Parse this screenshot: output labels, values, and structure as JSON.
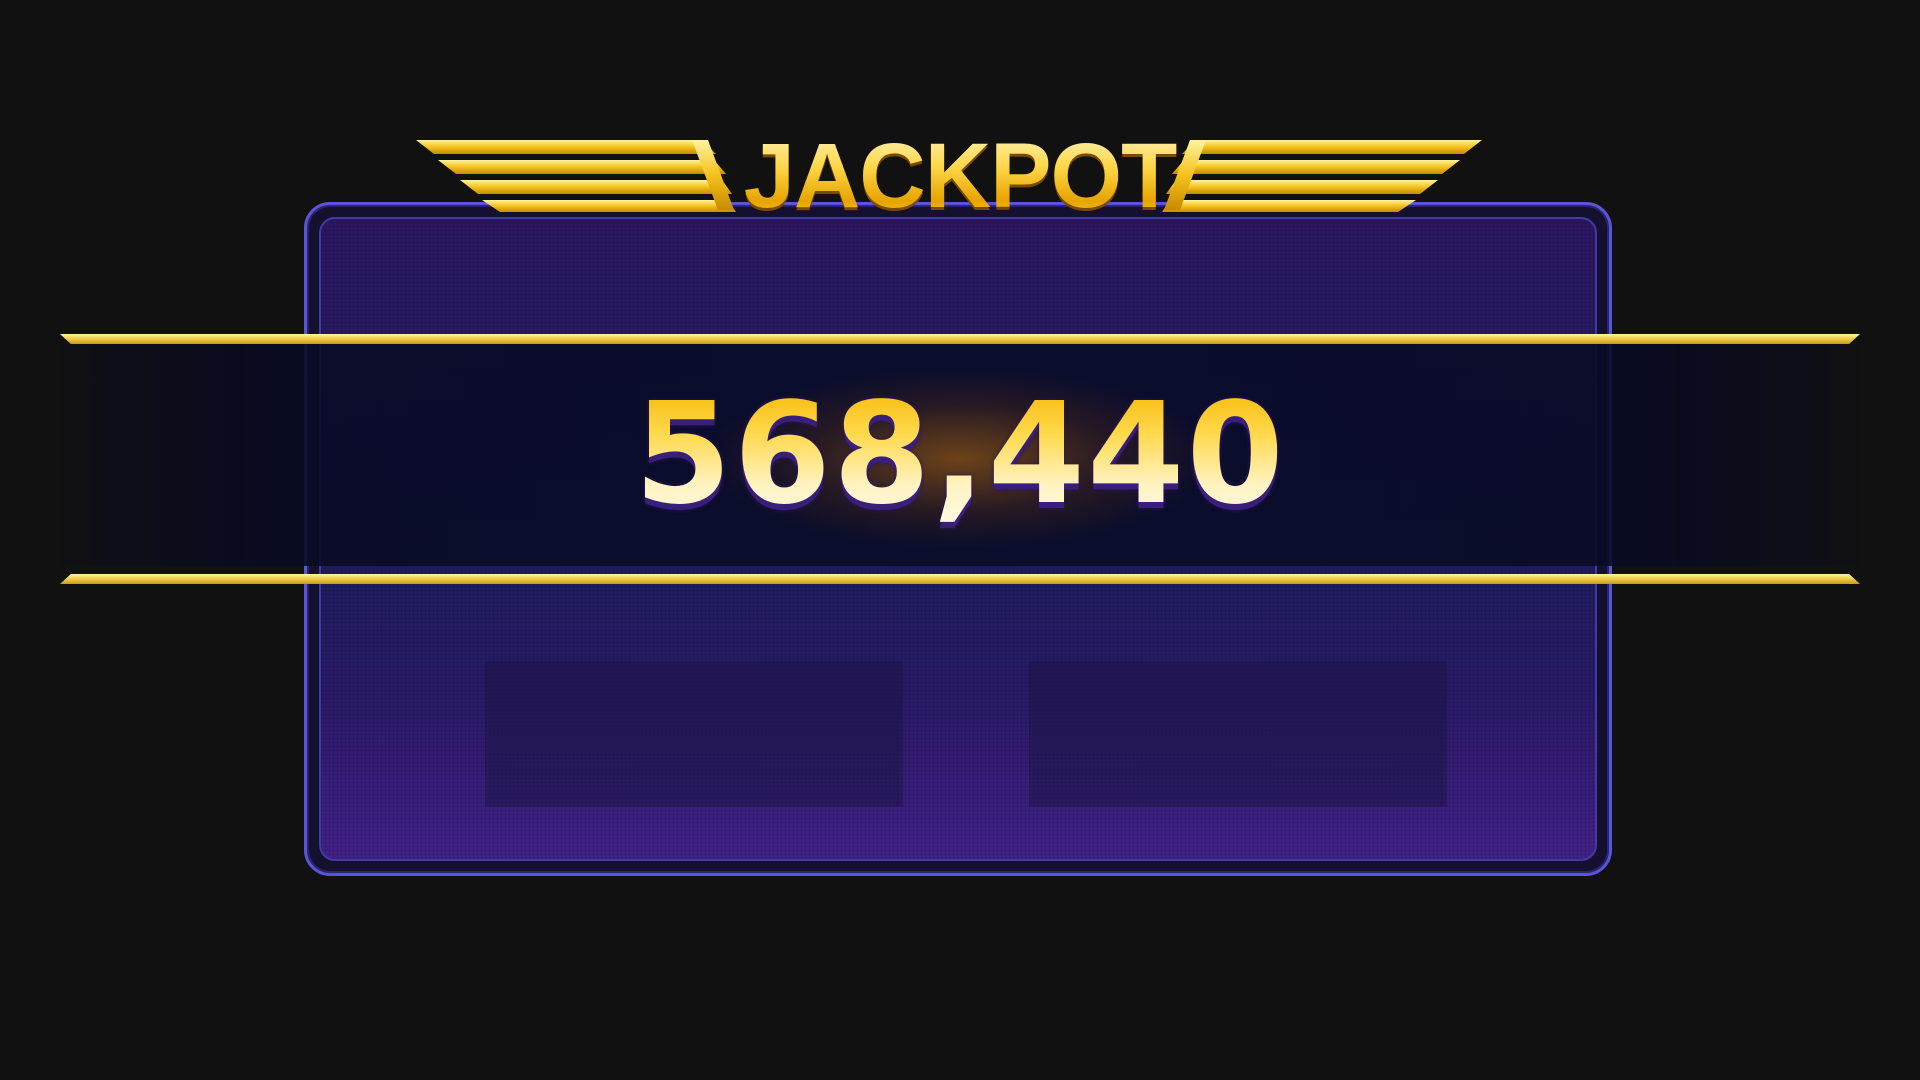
{
  "jackpot": {
    "title": "JACKPOT",
    "amount": "568,440"
  },
  "colors": {
    "background": "#111111",
    "panel_border": "#5a55d8",
    "gold": "#ffd54a",
    "band_dark": "#080c28"
  },
  "icons": {
    "wings": "gold-wings-icon"
  }
}
